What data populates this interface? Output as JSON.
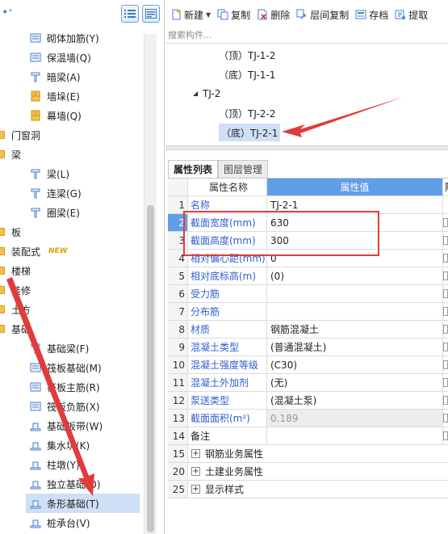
{
  "left_tree": {
    "items": [
      {
        "type": "leaf",
        "label": "砌体加筋(Y)",
        "icon": "masonry-rebar-icon"
      },
      {
        "type": "leaf",
        "label": "保温墙(Q)",
        "icon": "insulation-wall-icon"
      },
      {
        "type": "leaf",
        "label": "暗梁(A)",
        "icon": "hidden-beam-icon"
      },
      {
        "type": "leaf",
        "label": "墙垛(E)",
        "icon": "wall-pier-icon"
      },
      {
        "type": "leaf",
        "label": "幕墙(Q)",
        "icon": "curtain-wall-icon"
      },
      {
        "type": "category",
        "label": "门窗洞"
      },
      {
        "type": "category",
        "label": "梁"
      },
      {
        "type": "leaf",
        "label": "梁(L)",
        "icon": "beam-icon"
      },
      {
        "type": "leaf",
        "label": "连梁(G)",
        "icon": "coupling-beam-icon"
      },
      {
        "type": "leaf",
        "label": "圈梁(E)",
        "icon": "ring-beam-icon"
      },
      {
        "type": "category",
        "label": "板"
      },
      {
        "type": "category",
        "label": "装配式",
        "badge": "NEW"
      },
      {
        "type": "category",
        "label": "楼梯"
      },
      {
        "type": "category",
        "label": "装修"
      },
      {
        "type": "category",
        "label": "土方"
      },
      {
        "type": "category",
        "label": "基础"
      },
      {
        "type": "leaf",
        "label": "基础梁(F)",
        "icon": "foundation-beam-icon"
      },
      {
        "type": "leaf",
        "label": "筏板基础(M)",
        "icon": "raft-foundation-icon"
      },
      {
        "type": "leaf",
        "label": "筏板主筋(R)",
        "icon": "raft-main-rebar-icon"
      },
      {
        "type": "leaf",
        "label": "筏板负筋(X)",
        "icon": "raft-negative-rebar-icon"
      },
      {
        "type": "leaf",
        "label": "基础板带(W)",
        "icon": "foundation-strip-icon"
      },
      {
        "type": "leaf",
        "label": "集水坑(K)",
        "icon": "sump-pit-icon"
      },
      {
        "type": "leaf",
        "label": "柱墩(Y)",
        "icon": "column-pier-icon"
      },
      {
        "type": "leaf",
        "label": "独立基础(D)",
        "icon": "isolated-footing-icon"
      },
      {
        "type": "leaf",
        "label": "条形基础(T)",
        "icon": "strip-footing-icon",
        "selected": true
      },
      {
        "type": "leaf",
        "label": "桩承台(V)",
        "icon": "pile-cap-icon"
      }
    ]
  },
  "toolbar": {
    "new_label": "新建",
    "copy_label": "复制",
    "delete_label": "删除",
    "floor_copy_label": "层间复制",
    "save_label": "存档",
    "extract_label": "提取"
  },
  "search": {
    "placeholder": "搜索构件..."
  },
  "component_tree": {
    "items": [
      {
        "label": "（顶）TJ-1-2",
        "level": 2
      },
      {
        "label": "（底）TJ-1-1",
        "level": 2
      },
      {
        "label": "TJ-2",
        "level": 1
      },
      {
        "label": "（顶）TJ-2-2",
        "level": 2
      },
      {
        "label": "（底）TJ-2-1",
        "level": 2,
        "selected": true
      }
    ]
  },
  "tabs": {
    "properties": "属性列表",
    "layers": "图层管理"
  },
  "property_grid": {
    "headers": {
      "name": "属性名称",
      "value": "属性值",
      "extra": "附"
    },
    "rows": [
      {
        "num": "1",
        "name": "名称",
        "value": "TJ-2-1",
        "blue": true
      },
      {
        "num": "2",
        "name": "截面宽度(mm)",
        "value": "630",
        "blue": true,
        "checkbox": true
      },
      {
        "num": "3",
        "name": "截面高度(mm)",
        "value": "300",
        "blue": true,
        "checkbox": true
      },
      {
        "num": "4",
        "name": "相对偏心距(mm)",
        "value": "0",
        "blue": true,
        "checkbox": true
      },
      {
        "num": "5",
        "name": "相对底标高(m)",
        "value": "(0)",
        "blue": true,
        "checkbox": true
      },
      {
        "num": "6",
        "name": "受力筋",
        "value": "",
        "blue": true,
        "checkbox": true
      },
      {
        "num": "7",
        "name": "分布筋",
        "value": "",
        "blue": true,
        "checkbox": true
      },
      {
        "num": "8",
        "name": "材质",
        "value": "钢筋混凝土",
        "blue": true,
        "checkbox": true
      },
      {
        "num": "9",
        "name": "混凝土类型",
        "value": "(普通混凝土)",
        "blue": true,
        "checkbox": true
      },
      {
        "num": "10",
        "name": "混凝土强度等级",
        "value": "(C30)",
        "blue": true,
        "checkbox": true
      },
      {
        "num": "11",
        "name": "混凝土外加剂",
        "value": "(无)",
        "blue": true,
        "checkbox": true
      },
      {
        "num": "12",
        "name": "泵送类型",
        "value": "(混凝土泵)",
        "blue": true,
        "checkbox": true
      },
      {
        "num": "13",
        "name": "截面面积(m²)",
        "value": "0.189",
        "blue": true,
        "checkbox": true,
        "readonly": true
      },
      {
        "num": "14",
        "name": "备注",
        "value": "",
        "blue": false,
        "checkbox": true
      }
    ],
    "groups": [
      {
        "num": "15",
        "label": "钢筋业务属性"
      },
      {
        "num": "20",
        "label": "土建业务属性"
      },
      {
        "num": "25",
        "label": "显示样式"
      }
    ]
  },
  "colors": {
    "annotation": "#e23b3b",
    "header_blue": "#5f9fe8",
    "link_blue": "#2f5fd0"
  }
}
